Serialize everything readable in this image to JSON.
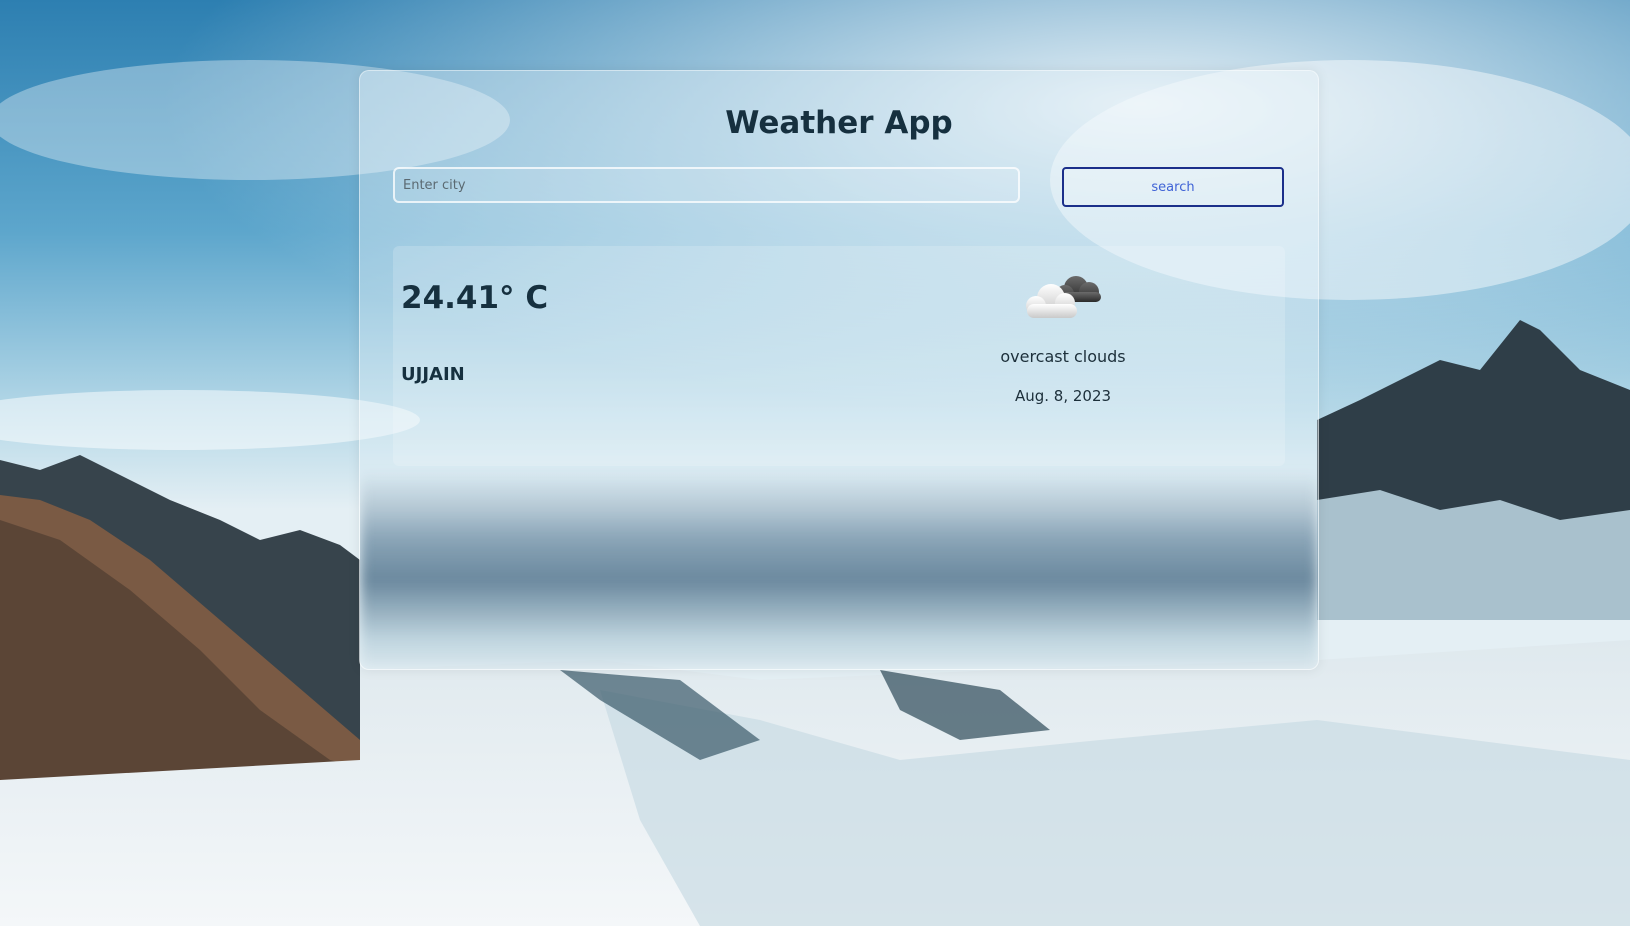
{
  "app": {
    "title": "Weather App"
  },
  "search": {
    "placeholder": "Enter city",
    "value": "",
    "button_label": "search"
  },
  "weather": {
    "temperature": "24.41° C",
    "city": "UJJAIN",
    "description": "overcast clouds",
    "date": "Aug. 8, 2023",
    "icon": "overcast-clouds-icon"
  },
  "colors": {
    "title_text": "#16303f",
    "button_border": "#1b2f8a",
    "button_text": "#3f63d6"
  }
}
